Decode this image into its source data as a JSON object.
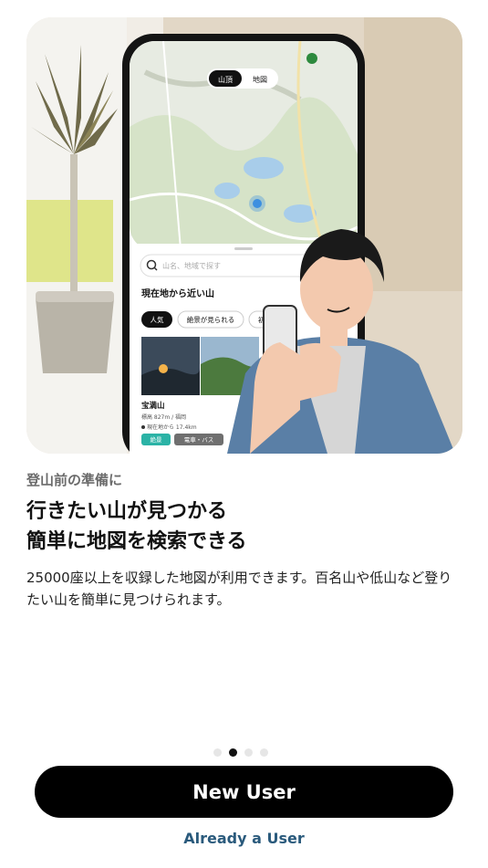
{
  "hero": {
    "map_tabs": [
      "山頂",
      "地図"
    ],
    "search_placeholder": "山名、地域で探す",
    "nearby_heading": "現在地から近い山",
    "filter_chips": [
      "人気",
      "絶景が見られる",
      "初"
    ],
    "mountain": {
      "name": "宝満山",
      "elevation": "標高 827m / 福岡",
      "distance": "現在地から 17.4km",
      "tags": [
        "絶景",
        "電車・バス"
      ]
    }
  },
  "content": {
    "subtitle": "登山前の準備に",
    "headline_line1": "行きたい山が見つかる",
    "headline_line2": "簡単に地図を検索できる",
    "body": "25000座以上を収録した地図が利用できます。百名山や低山など登りたい山を簡単に見つけられます。"
  },
  "pagination": {
    "total": 4,
    "active_index": 1
  },
  "actions": {
    "new_user_label": "New User",
    "already_user_label": "Already a User"
  },
  "colors": {
    "primary_button": "#000000",
    "link": "#2a5a7c",
    "tag_teal": "#2bb3a6"
  }
}
